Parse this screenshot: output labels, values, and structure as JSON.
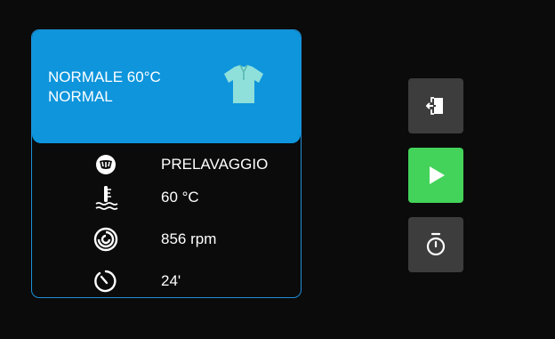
{
  "program": {
    "name_line1": "NORMALE 60°C",
    "name_line2": "NORMAL",
    "garment_icon": "polo-shirt-icon",
    "header_color": "#0e95dc",
    "border_color": "#1e8fd6"
  },
  "settings": [
    {
      "icon": "prewash-icon",
      "value": "PRELAVAGGIO"
    },
    {
      "icon": "temperature-icon",
      "value": "60 °C"
    },
    {
      "icon": "spin-icon",
      "value": "856 rpm"
    },
    {
      "icon": "duration-icon",
      "value": "24'"
    }
  ],
  "controls": {
    "exit_icon": "exit-door-icon",
    "start_icon": "play-icon",
    "start_color": "#43d35a",
    "delay_icon": "timer-icon",
    "button_color": "#3d3d3d"
  }
}
